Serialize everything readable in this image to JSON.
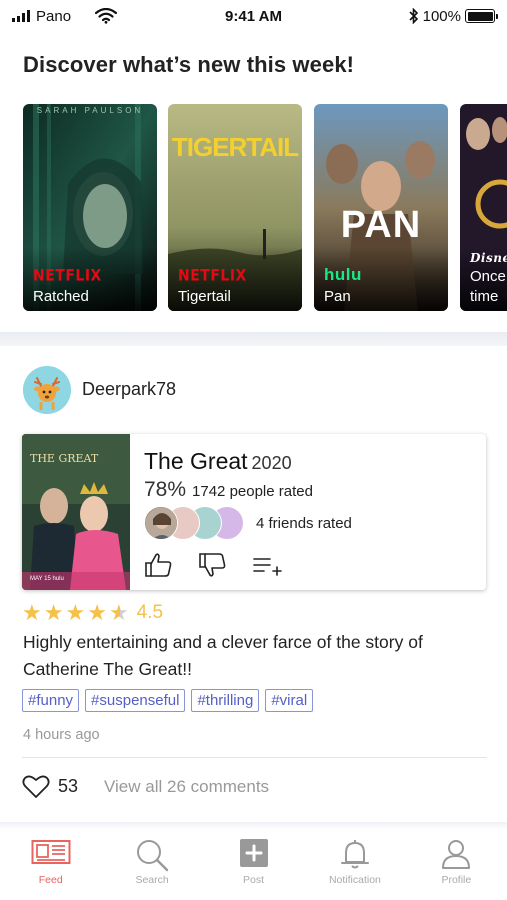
{
  "status_bar": {
    "carrier": "Pano",
    "time": "9:41 AM",
    "battery": "100%",
    "icons": [
      "signal-bars-icon",
      "wifi-icon",
      "bluetooth-icon",
      "battery-icon"
    ]
  },
  "discover": {
    "title": "Discover what’s new this week!",
    "cards": [
      {
        "title": "Ratched",
        "network": "NETFLIX",
        "poster_text": "SARAH PAULSON",
        "colors": [
          "#0f2a24",
          "#2d6b55"
        ]
      },
      {
        "title": "Tigertail",
        "network": "NETFLIX",
        "poster_text": "TIGERTAIL",
        "colors": [
          "#a7a86a",
          "#3f4a2a"
        ]
      },
      {
        "title": "Pan",
        "network": "hulu",
        "poster_text": "PAN",
        "colors": [
          "#7aa6c8",
          "#3a3025"
        ]
      },
      {
        "title": "Once Upon a time",
        "title_line1": "Once",
        "title_line2": "time",
        "network": "Disney+",
        "poster_text": "",
        "colors": [
          "#3b2a33",
          "#1a1a2a"
        ]
      }
    ]
  },
  "post": {
    "username": "Deerpark78",
    "show": {
      "title": "The Great",
      "year": "2020",
      "rating_pct": "78%",
      "rating_count": "1742 people rated",
      "friends_label": "4 friends rated",
      "poster_title": "THE GREAT",
      "poster_date": "MAY 15 hulu",
      "friend_colors": [
        "#e8c9c4",
        "#a9d3d1",
        "#d6b8e8"
      ]
    },
    "rating": {
      "stars": 4.5,
      "score": "4.5"
    },
    "review": "Highly entertaining and a clever farce of the story of Catherine The Great!!",
    "tags": [
      "#funny",
      "#suspenseful",
      "#thrilling",
      "#viral"
    ],
    "time_ago": "4 hours ago",
    "likes": "53",
    "view_comments": "View all 26 comments"
  },
  "tabbar": {
    "items": [
      {
        "label": "Feed",
        "icon": "feed-icon",
        "active": true
      },
      {
        "label": "Search",
        "icon": "search-icon",
        "active": false
      },
      {
        "label": "Post",
        "icon": "post-icon",
        "active": false
      },
      {
        "label": "Notification",
        "icon": "bell-icon",
        "active": false
      },
      {
        "label": "Profile",
        "icon": "profile-icon",
        "active": false
      }
    ]
  },
  "colors": {
    "accent": "#e8645f",
    "tag": "#5560c6",
    "star": "#f4c24a"
  }
}
